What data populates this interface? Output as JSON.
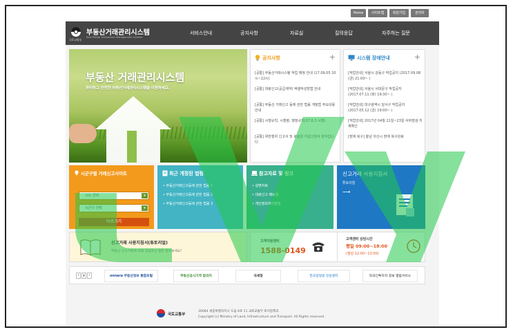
{
  "colors": {
    "header": "#444444",
    "region_box": "#f39a1c",
    "law_box": "#42b4c3",
    "ref_box": "#39b08d",
    "guide_box": "#1f78c4",
    "go_button": "#d4500f",
    "phone_text": "#e0541a",
    "watermark": "#23c94a"
  },
  "utility": [
    "Home",
    "사이트맵",
    "회원가입",
    "관리자"
  ],
  "header": {
    "logo_label": "국토교통부",
    "title": "부동산거래관리시스템",
    "title_en": "Real Estate Transaction Management System",
    "nav": [
      "서비스안내",
      "공지사항",
      "자료실",
      "질의응답",
      "자주하는 질문"
    ]
  },
  "hero": {
    "title": "부동산 거래관리시스템",
    "subtitle": "편리하고 안전한 부동산거래관리시스템을 이용하세요."
  },
  "notices": {
    "title": "공지사항",
    "items": [
      "[공통] 부동산거래시스템 작업 예정 안내 (17.09.05 20시~22시)",
      "[공통] 대량신고(공급계약) 엑셀작성방법 안내",
      "[공통] 부동산 거래신고 등에 관한 법률 개정법 주요내용 안내",
      "[공통] 시행규칙, 시행령, 행정규칙(17.6.3 시행)",
      "[공통] 위반행위 신고서 및 포상금 지급신청서 양식입니다."
    ]
  },
  "outage": {
    "title": "시스템 장애안내",
    "items": [
      "[작업안내] 서울시 강동구 작업공지 (2017.09.08 (금) 21:00~ )",
      "[작업안내] 서울시 서대문구 작업공지 (2017.07.11 (화) 19:30~ )",
      "[작업안내] 대구광역시 달서구 작업공지 (2017.05.12 (금) 19:00~ )",
      "[작업안내] 2017년 04월 21일~23일 서버점검 지체확인",
      "[장애 복구] 충남 아산시 장애 복구완료"
    ]
  },
  "region": {
    "title": "시군구별 거래신고사이트",
    "select_sido": "시도 선택",
    "select_sigungu": "시군구 선택",
    "go_label": "바로가기"
  },
  "law": {
    "title": "최근 개정된 법령",
    "items": [
      "부동산거래신고등에 관한 법률 1",
      "부동산거래신고등에 관한 법률 2",
      "부동산거래신고등에 관한 법률 3"
    ]
  },
  "refs": {
    "title": "참고자료 및 링크",
    "items": [
      "설명자료",
      "대량신고 매뉴얼",
      "개인정보처리방침"
    ]
  },
  "guide": {
    "title": "신고거래 사용지침서",
    "link": "튜토리얼"
  },
  "tutorial": {
    "title": "신고거래 사용지침서(튜토리얼)",
    "desc": "부동산 신고거래에 대해 궁금하신 점은 알아보세요!"
  },
  "callcenter": {
    "label": "고객지원센터",
    "phone": "1588-0149"
  },
  "hours": {
    "label": "고객센터 상담시간",
    "weekday": "평일 09:00~18:00",
    "lunch": "(점심 12:00~13:00)"
  },
  "partners": {
    "prev": "‹",
    "pause": "Ⅱ",
    "next": "›",
    "items": [
      "onnara 부동산정보 통합포털",
      "부동산공시가격 알리미",
      "국세청",
      "한국감정원 민원센터",
      "외국인투자자 정보 열람서비스"
    ]
  },
  "footer": {
    "ministry": "국토교통부",
    "address": "30084 세종특별자치시 도움 6로 11 국토교통부 토지정책과",
    "copyright": "Copyright (c) Ministry of Land, Infrastructure and Transport. All Rights reserved."
  }
}
